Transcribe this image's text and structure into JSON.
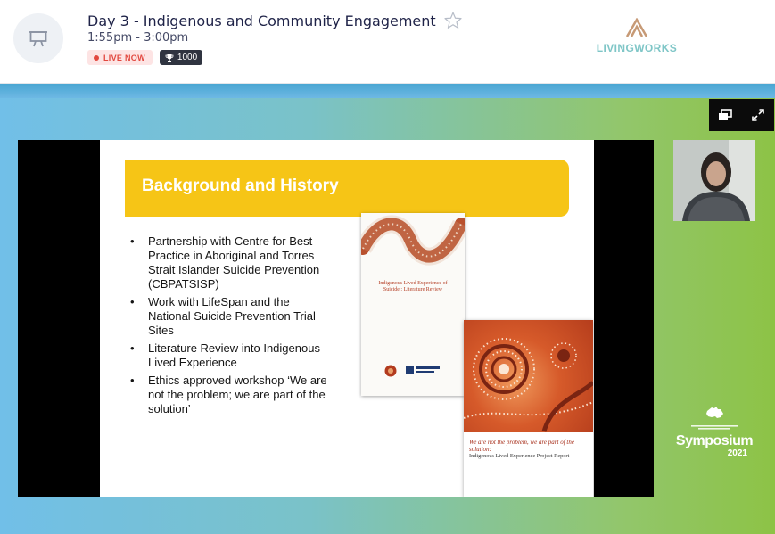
{
  "header": {
    "title": "Day 3 - Indigenous and Community Engagement",
    "time": "1:55pm - 3:00pm",
    "live_badge": "LIVE NOW",
    "attendee_count": "1000",
    "session_icon": "presentation-board-icon",
    "favorite_icon": "star-icon",
    "trophy_icon": "trophy-icon",
    "sponsor_logo": "LIVINGWORKS"
  },
  "colors": {
    "title": "#1f2348",
    "live_bg": "#fde4e4",
    "live_text": "#e2483f",
    "count_bg": "#2f3440",
    "logo_teal": "#7fc6c7",
    "banner_yellow": "#f6c516"
  },
  "controls": {
    "pip_icon": "picture-in-picture-icon",
    "fullscreen_icon": "fullscreen-icon"
  },
  "slide": {
    "heading": "Background and History",
    "bullets": [
      "Partnership with Centre for Best Practice in Aboriginal and Torres Strait Islander Suicide Prevention (CBPATSISP)",
      "Work with LifeSpan and the National Suicide Prevention Trial Sites",
      "Literature Review into Indigenous Lived Experience",
      "Ethics approved workshop ‘We are not the problem; we are part of the solution’"
    ],
    "cover1_title": "Indigenous Lived Experience of Suicide : Literature Review",
    "cover2_title": "We are not the problem, we are part of the solution:",
    "cover2_subtitle": "Indigenous Lived Experience Project Report"
  },
  "symposium": {
    "word": "Symposium",
    "year": "2021"
  }
}
